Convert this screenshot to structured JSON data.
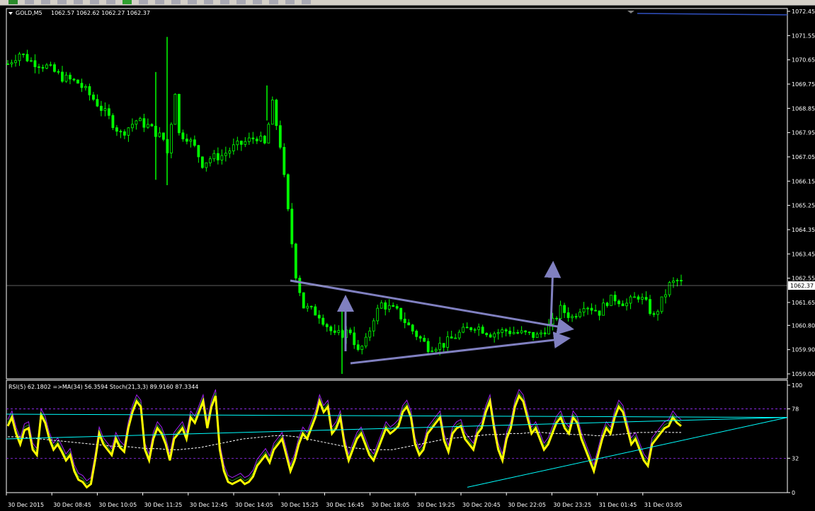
{
  "toolbar": {
    "buttons": [
      "green-arrow-icon",
      "chart-bars-icon",
      "chart-bars-icon",
      "chart-bars-icon",
      "chart-bars-icon",
      "pencil-icon",
      "pencil-icon",
      "new-order-icon",
      "autotrading-icon",
      "template-icon",
      "cursor-icon",
      "crosshair-icon",
      "vertical-line-icon",
      "horizontal-line-icon",
      "trendline-icon",
      "channel-icon",
      "fibonacci-icon",
      "text-icon",
      "label-icon"
    ]
  },
  "main": {
    "symbol_label": "GOLD,M5",
    "ohlc_text": "1062.57 1062.62 1062.27 1062.37",
    "current_price": "1062.37",
    "price_ticks": [
      "1072.45",
      "1071.55",
      "1070.65",
      "1069.75",
      "1068.85",
      "1067.95",
      "1067.05",
      "1066.15",
      "1065.25",
      "1064.35",
      "1063.45",
      "1062.55",
      "1061.65",
      "1060.80",
      "1059.90",
      "1059.00"
    ]
  },
  "indicator": {
    "label": "RSI(5) 62.1802  =>MA(34) 56.3594  Stoch(21,3,3) 89.9160 87.3344",
    "ticks": [
      "100",
      "78",
      "32",
      "0"
    ]
  },
  "time_labels": [
    "30 Dec 2015",
    "30 Dec 08:45",
    "30 Dec 10:05",
    "30 Dec 11:25",
    "30 Dec 12:45",
    "30 Dec 14:05",
    "30 Dec 15:25",
    "30 Dec 16:45",
    "30 Dec 18:05",
    "30 Dec 19:25",
    "30 Dec 20:45",
    "30 Dec 22:05",
    "30 Dec 23:25",
    "31 Dec 01:45",
    "31 Dec 03:05"
  ],
  "colors": {
    "candle": "#00ff00",
    "rsi": "#ffff00",
    "ma": "#ffffff",
    "stoch_main": "#a020f0",
    "stoch_signal": "#228b22",
    "trendline": "#00ffff",
    "pattern": "#8080c0",
    "level": "#9b30ff",
    "axis": "#ffffff",
    "background": "#000000"
  },
  "chart_data": [
    {
      "type": "candlestick",
      "title": "GOLD,M5",
      "ylim": [
        1059.0,
        1072.45
      ],
      "price_profile": [
        [
          0,
          1070.5
        ],
        [
          3,
          1070.9
        ],
        [
          6,
          1070.6
        ],
        [
          10,
          1070.4
        ],
        [
          14,
          1070.0
        ],
        [
          18,
          1069.8
        ],
        [
          22,
          1069.2
        ],
        [
          26,
          1068.5
        ],
        [
          29,
          1067.9
        ],
        [
          33,
          1068.4
        ],
        [
          36,
          1068.2
        ],
        [
          40,
          1067.7
        ],
        [
          41,
          1067.2
        ],
        [
          43,
          1069.5
        ],
        [
          44,
          1067.9
        ],
        [
          46,
          1067.8
        ],
        [
          48,
          1067.4
        ],
        [
          50,
          1066.8
        ],
        [
          52,
          1067.0
        ],
        [
          55,
          1067.1
        ],
        [
          58,
          1067.4
        ],
        [
          61,
          1067.6
        ],
        [
          64,
          1067.8
        ],
        [
          66,
          1067.5
        ],
        [
          68,
          1069.0
        ],
        [
          70,
          1067.5
        ],
        [
          72,
          1065.0
        ],
        [
          74,
          1062.7
        ],
        [
          76,
          1061.5
        ],
        [
          80,
          1061.2
        ],
        [
          84,
          1060.4
        ],
        [
          88,
          1060.6
        ],
        [
          90,
          1059.8
        ],
        [
          92,
          1060.2
        ],
        [
          94,
          1061.1
        ],
        [
          96,
          1061.6
        ],
        [
          100,
          1061.3
        ],
        [
          104,
          1060.6
        ],
        [
          108,
          1060.0
        ],
        [
          112,
          1060.1
        ],
        [
          116,
          1060.5
        ],
        [
          120,
          1060.8
        ],
        [
          124,
          1060.5
        ],
        [
          128,
          1060.6
        ],
        [
          132,
          1060.5
        ],
        [
          136,
          1060.4
        ],
        [
          140,
          1060.9
        ],
        [
          142,
          1061.4
        ],
        [
          145,
          1061.1
        ],
        [
          148,
          1061.6
        ],
        [
          152,
          1061.3
        ],
        [
          154,
          1061.7
        ],
        [
          156,
          1061.8
        ],
        [
          159,
          1061.6
        ],
        [
          162,
          1061.9
        ],
        [
          164,
          1061.6
        ],
        [
          166,
          1061.1
        ],
        [
          168,
          1061.7
        ],
        [
          170,
          1062.3
        ],
        [
          172,
          1062.45
        ],
        [
          173,
          1062.37
        ]
      ]
    },
    {
      "type": "line",
      "title": "RSI(5) 62.1802  =>MA(34) 56.3594  Stoch(21,3,3) 89.9160 87.3344",
      "ylim": [
        0,
        100
      ],
      "levels": [
        78,
        32
      ],
      "series": [
        {
          "name": "RSI(5)",
          "values": [
            62,
            70,
            55,
            45,
            58,
            60,
            40,
            35,
            72,
            65,
            50,
            40,
            45,
            38,
            30,
            35,
            20,
            12,
            10,
            5,
            8,
            30,
            55,
            45,
            40,
            35,
            50,
            42,
            38,
            60,
            75,
            85,
            80,
            40,
            30,
            50,
            60,
            55,
            45,
            30,
            50,
            55,
            60,
            50,
            70,
            65,
            75,
            85,
            60,
            80,
            90,
            40,
            20,
            10,
            8,
            10,
            12,
            8,
            10,
            15,
            25,
            30,
            35,
            28,
            40,
            45,
            50,
            35,
            20,
            30,
            45,
            55,
            50,
            60,
            70,
            85,
            75,
            80,
            55,
            60,
            70,
            45,
            30,
            40,
            50,
            55,
            45,
            35,
            30,
            40,
            50,
            60,
            55,
            58,
            62,
            75,
            80,
            70,
            45,
            35,
            40,
            55,
            60,
            65,
            70,
            48,
            38,
            55,
            60,
            62,
            50,
            45,
            40,
            55,
            60,
            75,
            85,
            60,
            40,
            30,
            50,
            60,
            80,
            90,
            85,
            70,
            55,
            60,
            50,
            40,
            45,
            55,
            65,
            70,
            60,
            55,
            70,
            65,
            50,
            40,
            30,
            20,
            35,
            50,
            60,
            55,
            70,
            80,
            75,
            60,
            45,
            50,
            40,
            30,
            25,
            45,
            50,
            55,
            60,
            62,
            70,
            65,
            62
          ]
        },
        {
          "name": "MA(34)",
          "values": [
            52,
            52,
            51,
            50,
            49,
            48,
            47,
            46,
            45,
            44,
            43,
            43,
            42,
            41,
            41,
            40,
            40,
            41,
            42,
            44,
            46,
            48,
            50,
            51,
            52,
            53,
            53,
            52,
            50,
            48,
            46,
            44,
            42,
            41,
            40,
            40,
            40,
            42,
            44,
            46,
            48,
            50,
            51,
            52,
            53,
            54,
            54,
            55,
            55,
            56,
            56,
            55,
            55,
            54,
            54,
            53,
            53,
            54,
            55,
            56,
            56,
            57,
            56,
            56
          ]
        }
      ],
      "trendlines": [
        {
          "name": "upper-trendline",
          "points": [
            [
              0,
              73
            ],
            [
              170,
              70
            ]
          ]
        },
        {
          "name": "middle-trendline",
          "points": [
            [
              0,
              50
            ],
            [
              170,
              70
            ]
          ]
        },
        {
          "name": "lower-trendline",
          "points": [
            [
              100,
              5
            ],
            [
              170,
              70
            ]
          ]
        }
      ]
    }
  ]
}
